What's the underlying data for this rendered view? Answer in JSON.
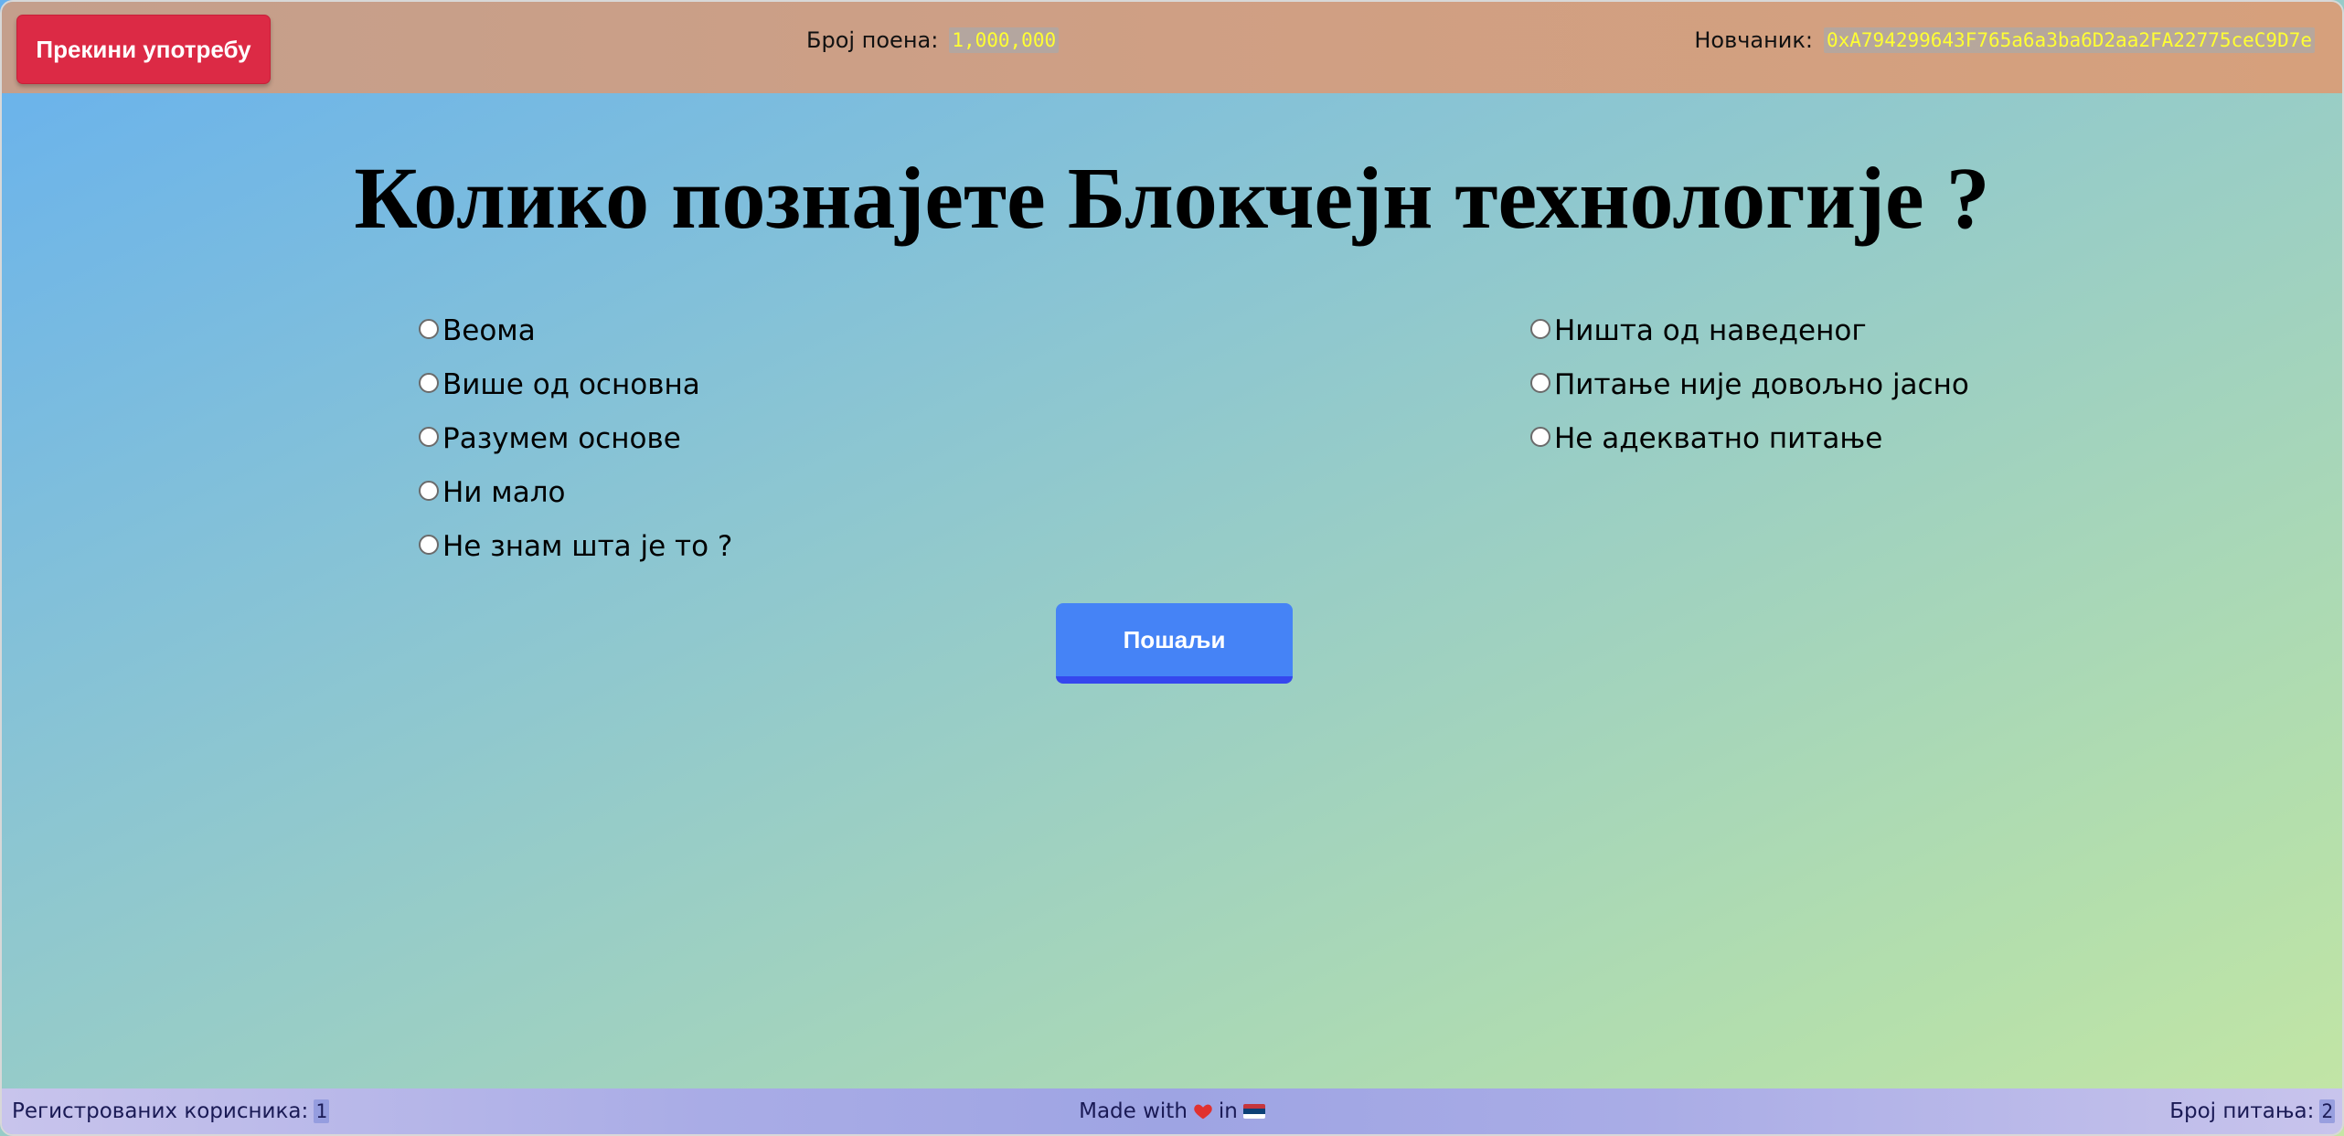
{
  "header": {
    "stop_button_label": "Прекини употребу",
    "points_label": "Број поена:",
    "points_value": "1,000,000",
    "wallet_label": "Новчаник:",
    "wallet_value": "0xA794299643F765a6a3ba6D2aa2FA22775ceC9D7e"
  },
  "quiz": {
    "question": "Колико познајете Блокчејн технологије ?",
    "answers_left": [
      {
        "label": "Веома"
      },
      {
        "label": "Више од основна"
      },
      {
        "label": "Разумем основе"
      },
      {
        "label": "Ни мало"
      },
      {
        "label": "Не знам шта је то ?"
      }
    ],
    "answers_right": [
      {
        "label": "Ништа од наведеног"
      },
      {
        "label": "Питање није довољно јасно"
      },
      {
        "label": "Не адекватно питање"
      }
    ],
    "submit_label": "Пошаљи"
  },
  "footer": {
    "registered_label": "Регистрованих корисника:",
    "registered_value": "1",
    "made_with_prefix": "Made with",
    "made_with_in": "in",
    "questions_label": "Број питања:",
    "questions_value": "2"
  },
  "icons": {
    "heart": "heart-icon",
    "flag": "serbia-flag-icon",
    "radio": "radio-unchecked-icon"
  },
  "colors": {
    "stop_button": "#dc2a45",
    "submit_button": "#4583f6",
    "badge_text": "#ffff33"
  }
}
